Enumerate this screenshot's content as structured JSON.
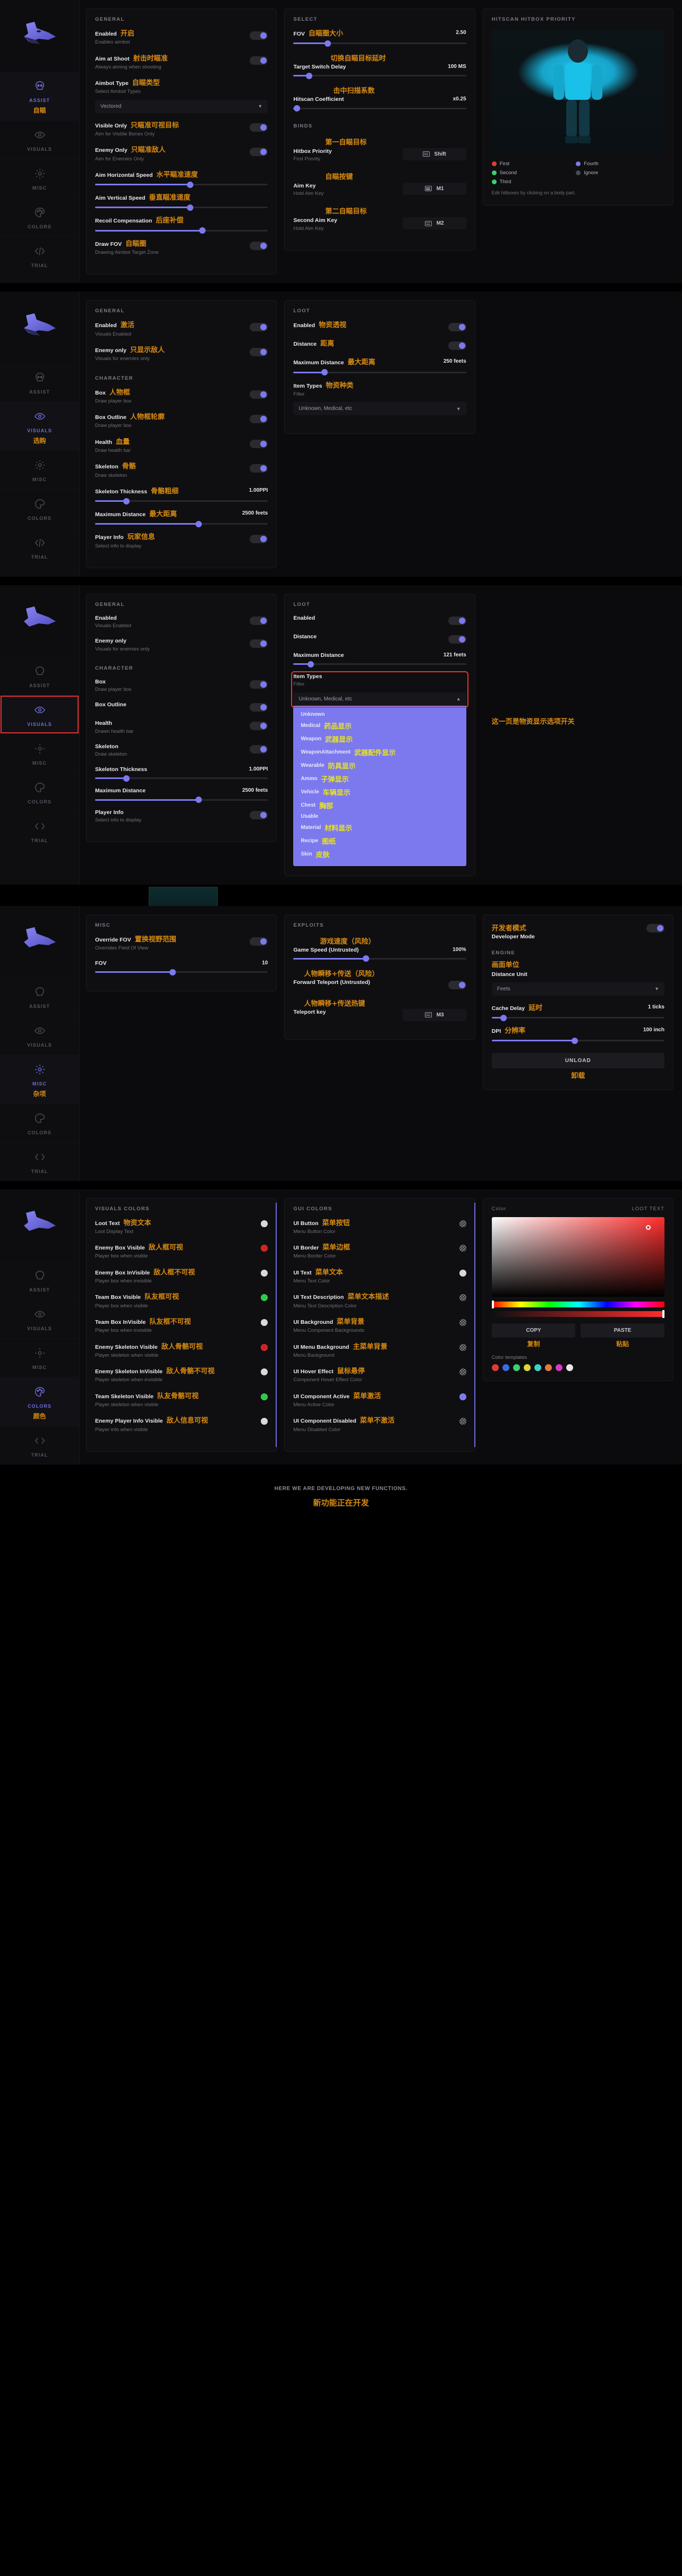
{
  "app": {
    "logo": "wolf-head-logo"
  },
  "nav": [
    {
      "id": "assist",
      "label": "ASSIST",
      "cn": "自瞄",
      "icon": "skull-icon"
    },
    {
      "id": "visuals",
      "label": "VISUALS",
      "cn": "",
      "icon": "eye-icon"
    },
    {
      "id": "misc",
      "label": "MISC",
      "cn": "",
      "icon": "gear-icon"
    },
    {
      "id": "colors",
      "label": "COLORS",
      "cn": "",
      "icon": "palette-icon"
    },
    {
      "id": "trial",
      "label": "TRIAL",
      "cn": "",
      "icon": "code-icon"
    }
  ],
  "nav_cn_overrides": {
    "visuals_sec2": "选购",
    "misc_sec4": "杂项",
    "colors_sec5": "颜色"
  },
  "section_assist": {
    "general": {
      "title": "GENERAL",
      "rows": [
        {
          "label": "Enabled",
          "sub": "Enables aimbot",
          "cn": "开启",
          "toggle": "on"
        },
        {
          "label": "Aim at Shoot",
          "sub": "Always aiming when shooting",
          "cn": "射击时瞄准",
          "toggle": "on"
        },
        {
          "label": "Aimbot Type",
          "sub": "Select Aimbot Types",
          "cn": "自瞄类型",
          "dropdown": "Vectored"
        },
        {
          "label": "Visible Only",
          "sub": "Aim for Visible Bones Only",
          "cn": "只瞄准可视目标",
          "toggle": "on"
        },
        {
          "label": "Enemy Only",
          "sub": "Aim for Enemies Only",
          "cn": "只瞄准敌人",
          "toggle": "on"
        },
        {
          "label": "Aim Horizontal Speed",
          "sub": "",
          "cn": "水平瞄准速度",
          "slider": 55
        },
        {
          "label": "Aim Vertical Speed",
          "sub": "",
          "cn": "垂直瞄准速度",
          "slider": 55
        },
        {
          "label": "Recoil Compensation",
          "sub": "",
          "cn": "后座补偿",
          "slider": 62
        },
        {
          "label": "Draw FOV",
          "sub": "Drawing Aimbot Target Zone",
          "cn": "自瞄圈",
          "toggle": "on"
        }
      ]
    },
    "select": {
      "title": "SELECT",
      "rows": [
        {
          "label": "FOV",
          "cn": "自瞄圈大小",
          "value": "2.50",
          "slider": 20
        },
        {
          "label": "Target Switch Delay",
          "cn": "切换自瞄目标延时",
          "value": "100 MS",
          "slider": 9
        },
        {
          "label": "Hitscan Coefficient",
          "cn": "击中扫描系数",
          "value": "x0.25",
          "slider": 2
        }
      ]
    },
    "binds": {
      "title": "BINDS",
      "rows": [
        {
          "label": "Hitbox Priority",
          "sub": "First Priority",
          "cn": "第一自瞄目标",
          "key": "Shift"
        },
        {
          "label": "Aim Key",
          "sub": "Hold Aim Key",
          "cn": "自瞄按键",
          "key": "M1"
        },
        {
          "label": "Second Aim Key",
          "sub": "Hold Aim Key",
          "cn": "第二自瞄目标",
          "key": "M2"
        }
      ]
    },
    "hitbox": {
      "title": "HITSCAN HITBOX PRIORITY",
      "legend": [
        {
          "text": "First",
          "color": "#e03b3b"
        },
        {
          "text": "Fourth",
          "color": "#7c79ef"
        },
        {
          "text": "Second",
          "color": "#3bd16f"
        },
        {
          "text": "Ignore",
          "color": "#4a4a55"
        },
        {
          "text": "Third",
          "color": "#3bd16f"
        }
      ],
      "footer": "Edit hitboxes by clicking on a body part."
    }
  },
  "section_visuals_a": {
    "general": {
      "title": "GENERAL",
      "rows": [
        {
          "label": "Enabled",
          "sub": "Visuals Enabled",
          "cn": "激活",
          "toggle": "on"
        },
        {
          "label": "Enemy only",
          "sub": "Visuals for enemies only",
          "cn": "只显示敌人",
          "toggle": "on"
        }
      ]
    },
    "character": {
      "title": "CHARACTER",
      "rows": [
        {
          "label": "Box",
          "sub": "Draw player box",
          "cn": "人物框",
          "toggle": "on"
        },
        {
          "label": "Box Outline",
          "sub": "Draw player box",
          "cn": "人物框轮廓",
          "toggle": "on"
        },
        {
          "label": "Health",
          "sub": "Draw health bar",
          "cn": "血量",
          "toggle": "on"
        },
        {
          "label": "Skeleton",
          "sub": "Draw skeleton",
          "cn": "骨骼",
          "toggle": "on"
        },
        {
          "label": "Skeleton Thickness",
          "sub": "",
          "cn": "骨骼粗细",
          "value": "1.00PPI",
          "slider": 18
        },
        {
          "label": "Maximum Distance",
          "sub": "",
          "cn": "最大距离",
          "value": "2500 feets",
          "slider": 60
        },
        {
          "label": "Player Info",
          "sub": "Select info to display",
          "cn": "玩家信息",
          "toggle": "on"
        }
      ]
    },
    "loot": {
      "title": "LOOT",
      "rows": [
        {
          "label": "Enabled",
          "sub": "",
          "cn": "物资透视",
          "toggle": "on"
        },
        {
          "label": "Distance",
          "sub": "",
          "cn": "距离",
          "toggle": "on"
        },
        {
          "label": "Maximum Distance",
          "sub": "",
          "cn": "最大距离",
          "value": "250 feets",
          "slider": 18
        },
        {
          "label": "Item Types",
          "sub": "Filter",
          "cn": "物资种类",
          "dropdown": "Unknown, Medical, etc"
        }
      ]
    }
  },
  "section_visuals_b": {
    "general": {
      "title": "GENERAL",
      "rows": [
        {
          "label": "Enabled",
          "sub": "Visuals Enabled",
          "cn": "",
          "toggle": "on"
        },
        {
          "label": "Enemy only",
          "sub": "Visuals for enemies only",
          "cn": "",
          "toggle": "on"
        }
      ]
    },
    "character": {
      "title": "CHARACTER",
      "rows": [
        {
          "label": "Box",
          "sub": "Draw player box",
          "cn": "",
          "toggle": "on"
        },
        {
          "label": "Box Outline",
          "sub": "",
          "cn": "",
          "toggle": "on"
        },
        {
          "label": "Health",
          "sub": "Drawn health bar",
          "cn": "",
          "toggle": "on"
        },
        {
          "label": "Skeleton",
          "sub": "Draw skeleton",
          "cn": "",
          "toggle": "on"
        },
        {
          "label": "Skeleton Thickness",
          "sub": "",
          "cn": "",
          "value": "1.00PPI",
          "slider": 18
        },
        {
          "label": "Maximum Distance",
          "sub": "",
          "cn": "",
          "value": "2500 feets",
          "slider": 60
        },
        {
          "label": "Player Info",
          "sub": "Select info to display",
          "cn": "",
          "toggle": "on"
        }
      ]
    },
    "loot": {
      "title": "LOOT",
      "rows": [
        {
          "label": "Enabled",
          "sub": "",
          "cn": "",
          "toggle": "on"
        },
        {
          "label": "Distance",
          "sub": "",
          "cn": "",
          "toggle": "on"
        },
        {
          "label": "Maximum Distance",
          "sub": "",
          "cn": "",
          "value": "121 feets",
          "slider": 10
        }
      ],
      "item_types": {
        "label": "Item Types",
        "sub": "Filter",
        "selected": "Unknown, Medical, etc",
        "note_cn": "这一页是物资显示选项开关",
        "options": [
          {
            "en": "Unknown",
            "cn": ""
          },
          {
            "en": "Medical",
            "cn": "药品显示"
          },
          {
            "en": "Weapon",
            "cn": "武器显示"
          },
          {
            "en": "WeaponAttachment",
            "cn": "武器配件显示"
          },
          {
            "en": "Wearable",
            "cn": "防具显示"
          },
          {
            "en": "Ammo",
            "cn": "子弹显示"
          },
          {
            "en": "Vehicle",
            "cn": "车辆显示"
          },
          {
            "en": "Chest",
            "cn": "胸部"
          },
          {
            "en": "Usable",
            "cn": ""
          },
          {
            "en": "Material",
            "cn": "材料显示"
          },
          {
            "en": "Recipe",
            "cn": "图纸"
          },
          {
            "en": "Skin",
            "cn": "皮肤"
          }
        ]
      }
    }
  },
  "section_misc": {
    "misc": {
      "title": "MISC",
      "rows": [
        {
          "label": "Override FOV",
          "sub": "Overrides Field Of View",
          "cn": "置换视野范围",
          "toggle": "on"
        },
        {
          "label": "FOV",
          "sub": "",
          "cn": "",
          "value": "10",
          "slider": 45
        }
      ]
    },
    "exploits": {
      "title": "EXPLOITS",
      "rows": [
        {
          "label": "Game Speed (Untrusted)",
          "sub": "",
          "cn": "游戏速度（风险）",
          "value": "100%",
          "slider": 42
        },
        {
          "label": "Forward Teleport (Untrusted)",
          "sub": "",
          "cn": "人物瞬移+传送（风险）",
          "toggle": "on"
        },
        {
          "label": "Teleport key",
          "sub": "",
          "cn": "人物瞬移+传送热键",
          "key": "M3"
        }
      ]
    },
    "developer": {
      "title": "Developer Mode",
      "title_cn": "开发者模式",
      "toggle": "on",
      "engine_title": "ENGINE",
      "engine_cn": "画面单位",
      "rows": [
        {
          "label": "Distance Unit",
          "cn": "",
          "dropdown": "Feets"
        },
        {
          "label": "Cache Delay",
          "cn": "延时",
          "value": "1 ticks",
          "slider": 7
        },
        {
          "label": "DPI",
          "cn": "分辨率",
          "value": "100 inch",
          "slider": 48
        }
      ],
      "unload_label": "UNLOAD",
      "unload_cn": "卸载"
    }
  },
  "section_colors": {
    "visuals_colors": {
      "title": "VISUALS COLORS",
      "rows": [
        {
          "label": "Loot Text",
          "sub": "Loot Display Text",
          "cn": "物资文本",
          "color": "#d8d8d8"
        },
        {
          "label": "Enemy Box Visible",
          "sub": "Player box when visible",
          "cn": "敌人框可视",
          "color": "#d42020"
        },
        {
          "label": "Enemy Box InVisible",
          "sub": "Player box when invisible",
          "cn": "敌人框不可视",
          "color": "#d8d8d8"
        },
        {
          "label": "Team Box Visible",
          "sub": "Player box when visible",
          "cn": "队友框可视",
          "color": "#2fc94a"
        },
        {
          "label": "Team Box InVisible",
          "sub": "Player box when invisible",
          "cn": "队友框不可视",
          "color": "#d8d8d8"
        },
        {
          "label": "Enemy Skeleton Visible",
          "sub": "Player skeleton when visible",
          "cn": "敌人骨骼可视",
          "color": "#d42020"
        },
        {
          "label": "Enemy Skeleton InVisible",
          "sub": "Player skeleton when invisible",
          "cn": "敌人骨骼不可视",
          "color": "#d8d8d8"
        },
        {
          "label": "Team Skeleton Visible",
          "sub": "Player skeleton when visible",
          "cn": "队友骨骼可视",
          "color": "#2fc94a"
        },
        {
          "label": "Enemy Player Info Visible",
          "sub": "Player info when visible",
          "cn": "敌人信息可视",
          "color": "#d8d8d8"
        }
      ]
    },
    "gui_colors": {
      "title": "GUI COLORS",
      "rows": [
        {
          "label": "UI Button",
          "sub": "Menu Button Color",
          "cn": "菜单按钮",
          "color": "checker"
        },
        {
          "label": "UI Border",
          "sub": "Menu Border Color",
          "cn": "菜单边框",
          "color": "checker"
        },
        {
          "label": "UI Text",
          "sub": "Menu Text Color",
          "cn": "菜单文本",
          "color": "#d8d8d8"
        },
        {
          "label": "UI Text Description",
          "sub": "Menu Text Description Color",
          "cn": "菜单文本描述",
          "color": "checker"
        },
        {
          "label": "UI Background",
          "sub": "Menu Component Backgrounds",
          "cn": "菜单背景",
          "color": "checker"
        },
        {
          "label": "UI Menu Background",
          "sub": "Menu Background",
          "cn": "主菜单背景",
          "color": "checker"
        },
        {
          "label": "UI Hover Effect",
          "sub": "Component Hover Effect Color",
          "cn": "鼠标悬停",
          "color": "checker"
        },
        {
          "label": "UI Component Active",
          "sub": "Menu Active Color",
          "cn": "菜单激活",
          "color": "#7c79ef"
        },
        {
          "label": "UI Component Disabled",
          "sub": "Menu Disabled Color",
          "cn": "菜单不激活",
          "color": "checker"
        }
      ]
    },
    "picker": {
      "title": "Color",
      "right_title": "LOOT TEXT",
      "copy_label": "COPY",
      "copy_cn": "复制",
      "paste_label": "PASTE",
      "paste_cn": "粘贴",
      "templates_label": "Color templates",
      "templates": [
        "#e03b3b",
        "#3b6ce0",
        "#3bd16f",
        "#e0d23b",
        "#3bd1c4",
        "#e07a3b",
        "#d13bc4",
        "#e8e8e8"
      ]
    }
  },
  "footer": {
    "en": "HERE WE ARE DEVELOPING NEW FUNCTIONS.",
    "cn": "新功能正在开发"
  }
}
